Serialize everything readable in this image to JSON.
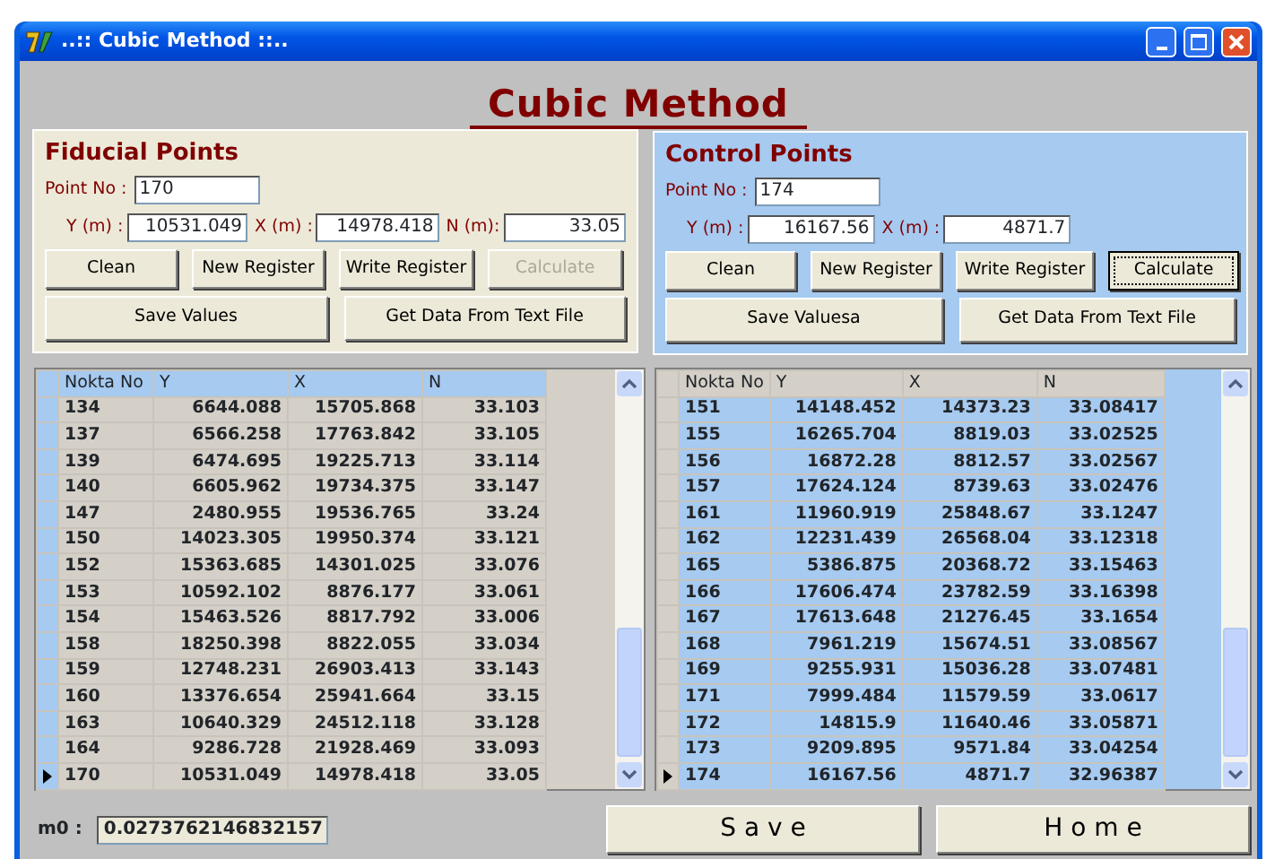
{
  "window": {
    "title": "..:: Cubic Method ::.."
  },
  "heading": "Cubic Method",
  "panels": [
    {
      "title": "Fiducial Points",
      "point_no": {
        "label": "Point No :",
        "value": "170"
      },
      "fields": [
        {
          "label": "Y (m) :",
          "value": "10531.049"
        },
        {
          "label": "X (m) :",
          "value": "14978.418"
        },
        {
          "label": "N (m):",
          "value": "33.05"
        }
      ],
      "buttons": [
        {
          "label": "Clean",
          "disabled": false,
          "focused": false
        },
        {
          "label": "New Register",
          "disabled": false,
          "focused": false
        },
        {
          "label": "Write Register",
          "disabled": false,
          "focused": false
        },
        {
          "label": "Calculate",
          "disabled": true,
          "focused": false
        }
      ],
      "wide_buttons": [
        {
          "label": "Save Values"
        },
        {
          "label": "Get Data From Text File"
        }
      ],
      "grid": {
        "columns": [
          "Nokta No",
          "Y",
          "X",
          "N"
        ],
        "rows": [
          {
            "cells": [
              "134",
              "6644.088",
              "15705.868",
              "33.103"
            ],
            "selected": false
          },
          {
            "cells": [
              "137",
              "6566.258",
              "17763.842",
              "33.105"
            ],
            "selected": false
          },
          {
            "cells": [
              "139",
              "6474.695",
              "19225.713",
              "33.114"
            ],
            "selected": false
          },
          {
            "cells": [
              "140",
              "6605.962",
              "19734.375",
              "33.147"
            ],
            "selected": false
          },
          {
            "cells": [
              "147",
              "2480.955",
              "19536.765",
              "33.24"
            ],
            "selected": false
          },
          {
            "cells": [
              "150",
              "14023.305",
              "19950.374",
              "33.121"
            ],
            "selected": false
          },
          {
            "cells": [
              "152",
              "15363.685",
              "14301.025",
              "33.076"
            ],
            "selected": false
          },
          {
            "cells": [
              "153",
              "10592.102",
              "8876.177",
              "33.061"
            ],
            "selected": false
          },
          {
            "cells": [
              "154",
              "15463.526",
              "8817.792",
              "33.006"
            ],
            "selected": false
          },
          {
            "cells": [
              "158",
              "18250.398",
              "8822.055",
              "33.034"
            ],
            "selected": false
          },
          {
            "cells": [
              "159",
              "12748.231",
              "26903.413",
              "33.143"
            ],
            "selected": false
          },
          {
            "cells": [
              "160",
              "13376.654",
              "25941.664",
              "33.15"
            ],
            "selected": false
          },
          {
            "cells": [
              "163",
              "10640.329",
              "24512.118",
              "33.128"
            ],
            "selected": false
          },
          {
            "cells": [
              "164",
              "9286.728",
              "21928.469",
              "33.093"
            ],
            "selected": false
          },
          {
            "cells": [
              "170",
              "10531.049",
              "14978.418",
              "33.05"
            ],
            "selected": true
          }
        ]
      }
    },
    {
      "title": "Control Points",
      "point_no": {
        "label": "Point No :",
        "value": "174"
      },
      "fields": [
        {
          "label": "Y (m) :",
          "value": "16167.56"
        },
        {
          "label": "X (m) :",
          "value": "4871.7"
        }
      ],
      "buttons": [
        {
          "label": "Clean",
          "disabled": false,
          "focused": false
        },
        {
          "label": "New Register",
          "disabled": false,
          "focused": false
        },
        {
          "label": "Write Register",
          "disabled": false,
          "focused": false
        },
        {
          "label": "Calculate",
          "disabled": false,
          "focused": true
        }
      ],
      "wide_buttons": [
        {
          "label": "Save Valuesa"
        },
        {
          "label": "Get Data From Text File"
        }
      ],
      "grid": {
        "columns": [
          "Nokta No",
          "Y",
          "X",
          "N"
        ],
        "rows": [
          {
            "cells": [
              "151",
              "14148.452",
              "14373.23",
              "33.08417"
            ],
            "selected": false
          },
          {
            "cells": [
              "155",
              "16265.704",
              "8819.03",
              "33.02525"
            ],
            "selected": false
          },
          {
            "cells": [
              "156",
              "16872.28",
              "8812.57",
              "33.02567"
            ],
            "selected": false
          },
          {
            "cells": [
              "157",
              "17624.124",
              "8739.63",
              "33.02476"
            ],
            "selected": false
          },
          {
            "cells": [
              "161",
              "11960.919",
              "25848.67",
              "33.1247"
            ],
            "selected": false
          },
          {
            "cells": [
              "162",
              "12231.439",
              "26568.04",
              "33.12318"
            ],
            "selected": false
          },
          {
            "cells": [
              "165",
              "5386.875",
              "20368.72",
              "33.15463"
            ],
            "selected": false
          },
          {
            "cells": [
              "166",
              "17606.474",
              "23782.59",
              "33.16398"
            ],
            "selected": false
          },
          {
            "cells": [
              "167",
              "17613.648",
              "21276.45",
              "33.1654"
            ],
            "selected": false
          },
          {
            "cells": [
              "168",
              "7961.219",
              "15674.51",
              "33.08567"
            ],
            "selected": false
          },
          {
            "cells": [
              "169",
              "9255.931",
              "15036.28",
              "33.07481"
            ],
            "selected": false
          },
          {
            "cells": [
              "171",
              "7999.484",
              "11579.59",
              "33.0617"
            ],
            "selected": false
          },
          {
            "cells": [
              "172",
              "14815.9",
              "11640.46",
              "33.05871"
            ],
            "selected": false
          },
          {
            "cells": [
              "173",
              "9209.895",
              "9571.84",
              "33.04254"
            ],
            "selected": false
          },
          {
            "cells": [
              "174",
              "16167.56",
              "4871.7",
              "32.96387"
            ],
            "selected": true
          }
        ]
      }
    }
  ],
  "m0": {
    "label": "m0 :",
    "value": "0.0273762146832157"
  },
  "bottom_buttons": [
    "S a v e",
    "H o m e"
  ]
}
